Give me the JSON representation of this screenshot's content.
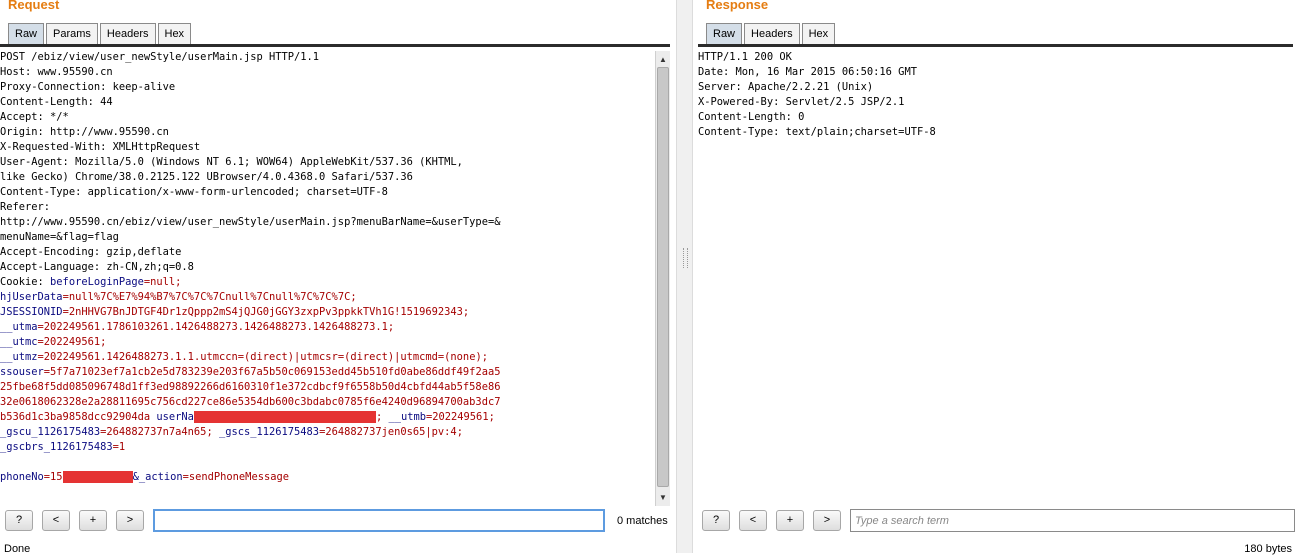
{
  "request": {
    "title": "Request",
    "tabs": [
      "Raw",
      "Params",
      "Headers",
      "Hex"
    ],
    "active_tab": "Raw",
    "lines": {
      "l1": "POST /ebiz/view/user_newStyle/userMain.jsp HTTP/1.1",
      "l2": "Host: www.95590.cn",
      "l3": "Proxy-Connection: keep-alive",
      "l4": "Content-Length: 44",
      "l5": "Accept: */*",
      "l6": "Origin: http://www.95590.cn",
      "l7": "X-Requested-With: XMLHttpRequest",
      "l8": "User-Agent: Mozilla/5.0 (Windows NT 6.1; WOW64) AppleWebKit/537.36 (KHTML,",
      "l9": "like Gecko) Chrome/38.0.2125.122 UBrowser/4.0.4368.0 Safari/537.36",
      "l10": "Content-Type: application/x-www-form-urlencoded; charset=UTF-8",
      "l11": "Referer:",
      "l12": "http://www.95590.cn/ebiz/view/user_newStyle/userMain.jsp?menuBarName=&userType=&",
      "l13": "menuName=&flag=flag",
      "l14": "Accept-Encoding: gzip,deflate",
      "l15": "Accept-Language: zh-CN,zh;q=0.8"
    },
    "cookie": {
      "prefix": "Cookie: ",
      "k1": "beforeLoginPage",
      "v1": "=null;",
      "k2": "hjUserData",
      "v2": "=null%7C%E7%94%B7%7C%7C%7Cnull%7Cnull%7C%7C%7C;",
      "k3": "JSESSIONID",
      "v3": "=2nHHVG7BnJDTGF4Dr1zQppp2mS4jQJG0jGGY3zxpPv3ppkkTVh1G!1519692343;",
      "k4": "__utma",
      "v4": "=202249561.1786103261.1426488273.1426488273.1426488273.1;",
      "k5": "__utmc",
      "v5": "=202249561;",
      "k6": "__utmz",
      "v6": "=202249561.1426488273.1.1.utmccn=(direct)|utmcsr=(direct)|utmcmd=(none);",
      "k7": "ssouser",
      "v7a": "=5f7a71023ef7a1cb2e5d783239e203f67a5b50c069153edd45b510fd0abe86ddf49f2aa5",
      "v7b": "25fbe68f5dd085096748d1ff3ed98892266d6160310f1e372cdbcf9f6558b50d4cbfd44ab5f58e86",
      "v7c": "32e0618062328e2a28811695c756cd227ce86e5354db600c3bdabc0785f6e4240d96894700ab3dc7",
      "v7d": "b536d1c3ba9858dcc92904da",
      "k8": "userNa",
      "k9": "__utmb",
      "v9": "=202249561;",
      "k10": "_gscu_1126175483",
      "v10": "=264882737n7a4n65;",
      "k11": "_gscs_1126175483",
      "v11": "=264882737jen0s65|pv:4;",
      "k12": "_gscbrs_1126175483",
      "v12": "=1"
    },
    "body_params": {
      "k1": "phoneNo",
      "v1": "=15",
      "k2": "&_action",
      "v2": "=sendPhoneMessage"
    },
    "search": {
      "value": "",
      "placeholder": ""
    },
    "matches": "0 matches",
    "status": "Done"
  },
  "response": {
    "title": "Response",
    "tabs": [
      "Raw",
      "Headers",
      "Hex"
    ],
    "active_tab": "Raw",
    "lines": {
      "l1": "HTTP/1.1 200 OK",
      "l2": "Date: Mon, 16 Mar 2015 06:50:16 GMT",
      "l3": "Server: Apache/2.2.21 (Unix)",
      "l4": "X-Powered-By: Servlet/2.5 JSP/2.1",
      "l5": "Content-Length: 0",
      "l6": "Content-Type: text/plain;charset=UTF-8"
    },
    "search": {
      "value": "",
      "placeholder": "Type a search term"
    },
    "status": "180 bytes"
  },
  "buttons": {
    "help": "?",
    "prev": "<",
    "add": "+",
    "next": ">"
  },
  "scroll_icons": {
    "up": "▲",
    "down": "▼"
  },
  "colors": {
    "title": "#e57d12",
    "header_key": "#0a0a80",
    "header_value": "#a50000",
    "redaction": "#e53333"
  }
}
